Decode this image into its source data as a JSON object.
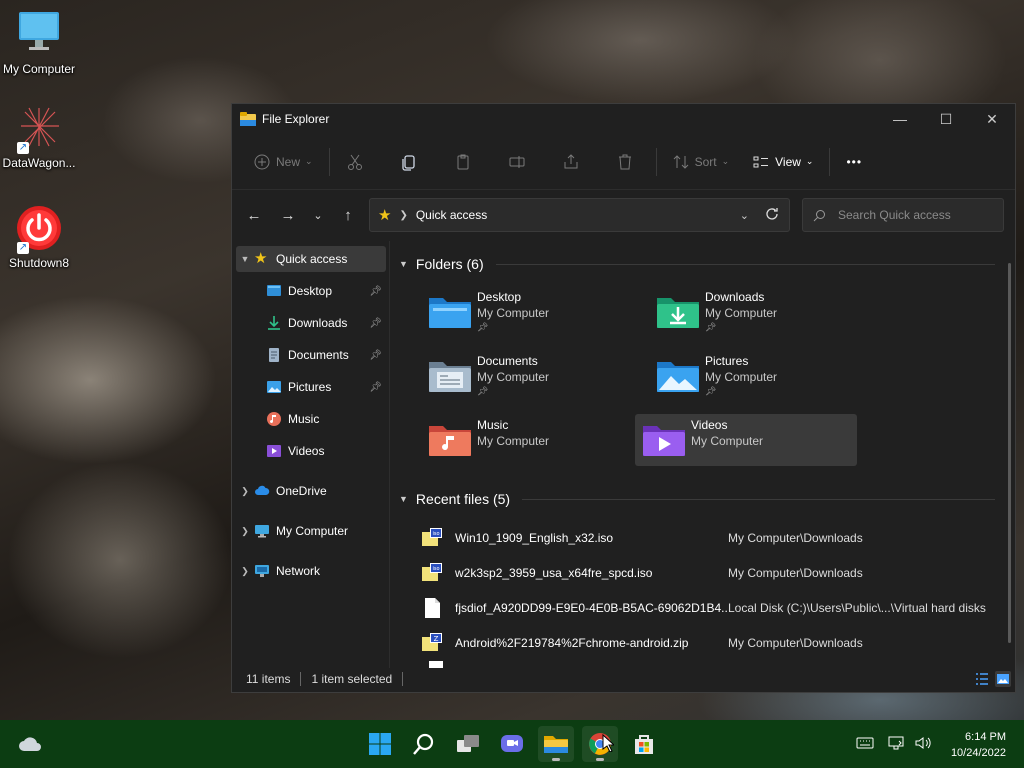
{
  "desktop": {
    "icons": [
      {
        "label": "My Computer"
      },
      {
        "label": "DataWagon..."
      },
      {
        "label": "Shutdown8"
      }
    ]
  },
  "window": {
    "title": "File Explorer",
    "controls": {
      "minimize": "—",
      "maximize": "☐",
      "close": "✕"
    }
  },
  "toolbar": {
    "new_label": "New",
    "sort_label": "Sort",
    "view_label": "View",
    "more_label": "•••"
  },
  "address": {
    "crumb": "Quick access",
    "search_placeholder": "Search Quick access"
  },
  "sidebar": {
    "items": [
      {
        "label": "Quick access"
      },
      {
        "label": "Desktop"
      },
      {
        "label": "Downloads"
      },
      {
        "label": "Documents"
      },
      {
        "label": "Pictures"
      },
      {
        "label": "Music"
      },
      {
        "label": "Videos"
      },
      {
        "label": "OneDrive"
      },
      {
        "label": "My Computer"
      },
      {
        "label": "Network"
      }
    ]
  },
  "folders": {
    "heading": "Folders (6)",
    "items": [
      {
        "name": "Desktop",
        "location": "My Computer"
      },
      {
        "name": "Downloads",
        "location": "My Computer"
      },
      {
        "name": "Documents",
        "location": "My Computer"
      },
      {
        "name": "Pictures",
        "location": "My Computer"
      },
      {
        "name": "Music",
        "location": "My Computer"
      },
      {
        "name": "Videos",
        "location": "My Computer"
      }
    ]
  },
  "recent": {
    "heading": "Recent files (5)",
    "items": [
      {
        "name": "Win10_1909_English_x32.iso",
        "location": "My Computer\\Downloads"
      },
      {
        "name": "w2k3sp2_3959_usa_x64fre_spcd.iso",
        "location": "My Computer\\Downloads"
      },
      {
        "name": "fjsdiof_A920DD99-E9E0-4E0B-B5AC-69062D1B4...",
        "location": "Local Disk (C:)\\Users\\Public\\...\\Virtual hard disks"
      },
      {
        "name": "Android%2F219784%2Fchrome-android.zip",
        "location": "My Computer\\Downloads"
      }
    ]
  },
  "status": {
    "count": "11 items",
    "selection": "1 item selected"
  },
  "taskbar": {
    "time": "6:14 PM",
    "date": "10/24/2022"
  },
  "colors": {
    "taskbar": "#0c3d12",
    "window_bg": "#202020",
    "accent": "#f0c419"
  }
}
